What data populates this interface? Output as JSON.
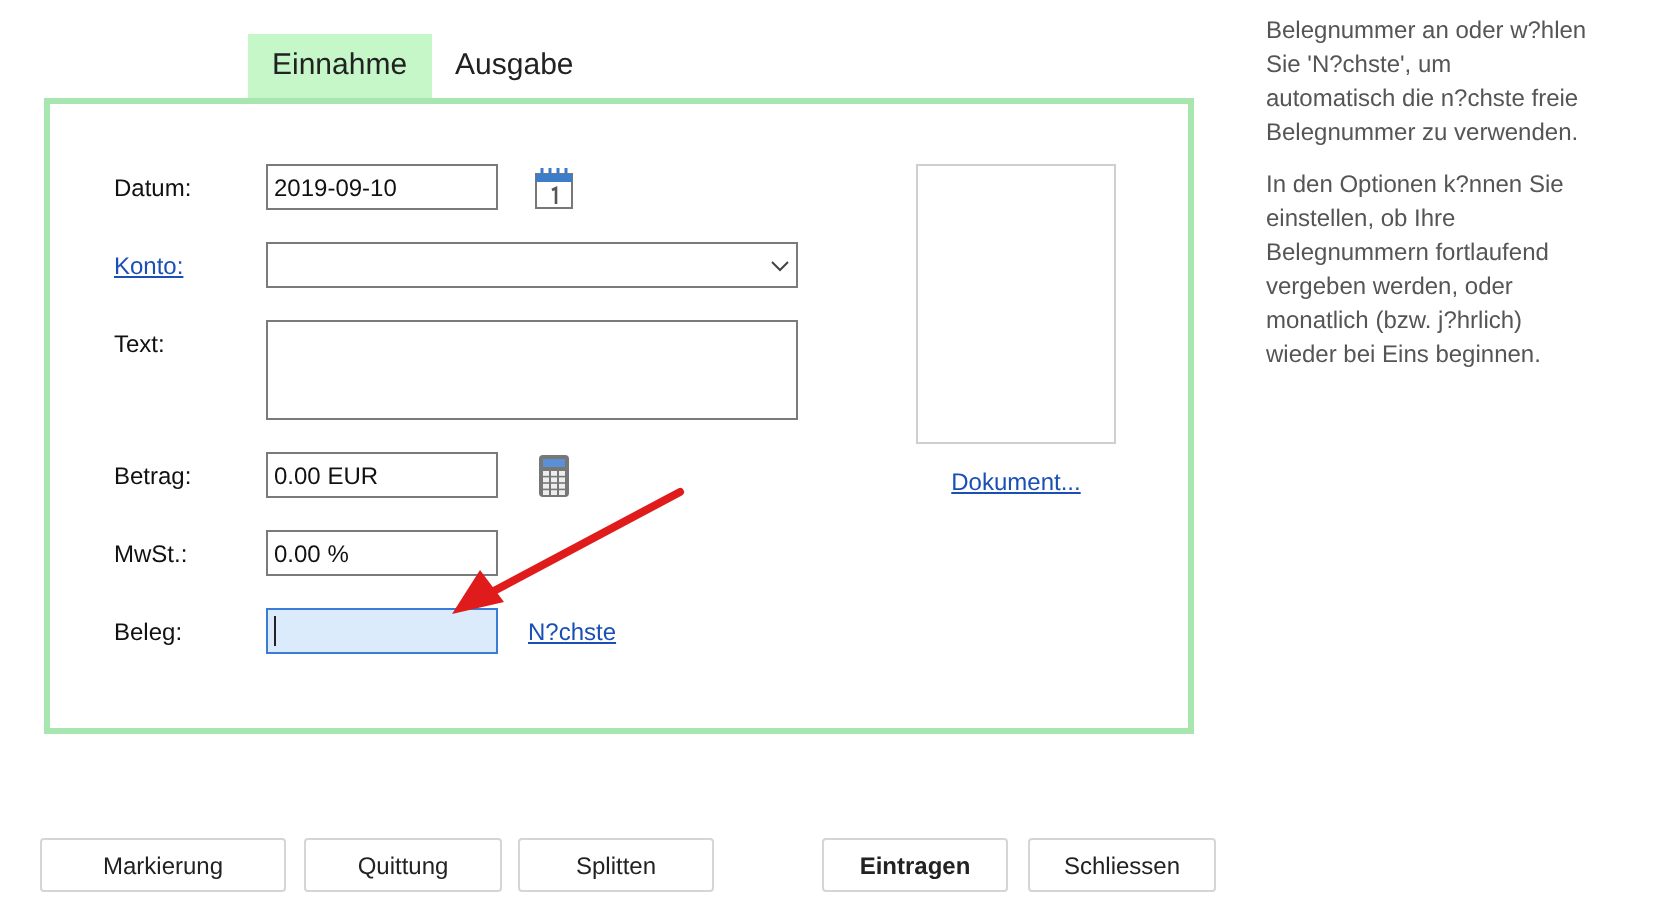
{
  "tabs": [
    {
      "label": "Einnahme",
      "selected": true
    },
    {
      "label": "Ausgabe",
      "selected": false
    }
  ],
  "fields": [
    {
      "label": "Datum:",
      "kind": "date",
      "value": "2019-09-10",
      "link": false,
      "focused": false
    },
    {
      "label": "Konto:",
      "kind": "select",
      "link": true,
      "focused": false
    },
    {
      "label": "Text:",
      "kind": "textarea",
      "link": false,
      "focused": false
    },
    {
      "label": "Betrag:",
      "kind": "amount",
      "value": "0.00 EUR",
      "link": false,
      "focused": false
    },
    {
      "label": "MwSt.:",
      "kind": "text",
      "value": "0.00 %",
      "link": false,
      "focused": false
    },
    {
      "label": "Beleg:",
      "kind": "next",
      "link": false,
      "focused": true,
      "action": "N?chste"
    }
  ],
  "document": {
    "link": "Dokument..."
  },
  "buttons": [
    {
      "label": "Markierung",
      "default": false
    },
    {
      "label": "Quittung",
      "default": false
    },
    {
      "label": "Splitten",
      "default": false
    },
    {
      "label": "Eintragen",
      "default": true
    },
    {
      "label": "Schliessen",
      "default": false
    }
  ],
  "help": [
    {
      "lines": [
        "Belegnummer an oder w?hlen",
        "Sie 'N?chste', um",
        "automatisch die n?chste freie",
        "Belegnummer zu verwenden."
      ]
    },
    {
      "lines": [
        "In den Optionen k?nnen Sie",
        "einstellen, ob Ihre",
        "Belegnummern fortlaufend",
        "vergeben werden, oder",
        "monatlich (bzw. j?hrlich)",
        "wieder bei Eins beginnen."
      ]
    }
  ]
}
